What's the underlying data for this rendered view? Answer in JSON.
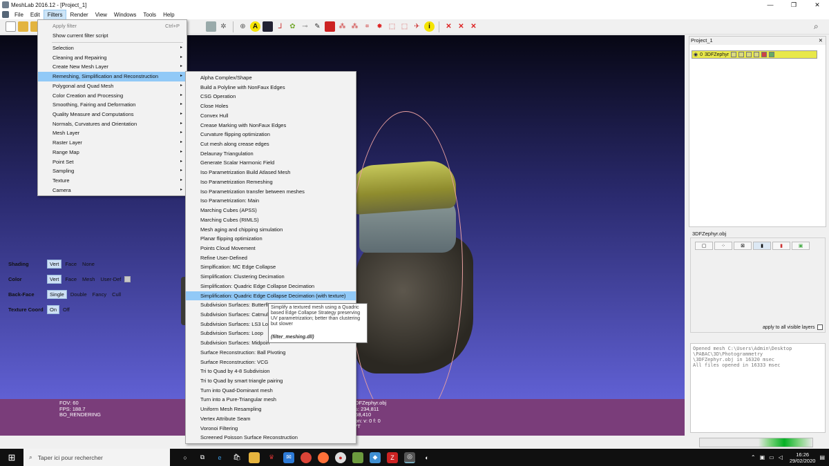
{
  "window": {
    "title": "MeshLab 2016.12 - [Project_1]",
    "minimize": "—",
    "restore": "❐",
    "close": "✕"
  },
  "menubar": [
    "File",
    "Edit",
    "Filters",
    "Render",
    "View",
    "Windows",
    "Tools",
    "Help"
  ],
  "filters_menu": {
    "apply": {
      "label": "Apply filter",
      "shortcut": "Ctrl+P"
    },
    "show_script": "Show current filter script",
    "items": [
      "Selection",
      "Cleaning and Repairing",
      "Create New Mesh Layer",
      "Remeshing, Simplification and Reconstruction",
      "Polygonal and Quad Mesh",
      "Color Creation and Processing",
      "Smoothing, Fairing and Deformation",
      "Quality Measure and Computations",
      "Normals, Curvatures and Orientation",
      "Mesh Layer",
      "Raster Layer",
      "Range Map",
      "Point Set",
      "Sampling",
      "Texture",
      "Camera"
    ],
    "highlighted_index": 3,
    "arrow": "▸"
  },
  "remesh_submenu": {
    "items": [
      "Alpha Complex/Shape",
      "Build a Polyline with NonFaux Edges",
      "CSG Operation",
      "Close Holes",
      "Convex Hull",
      "Crease Marking with NonFaux Edges",
      "Curvature flipping optimization",
      "Cut mesh along crease edges",
      "Delaunay Triangulation",
      "Generate Scalar Harmonic Field",
      "Iso Parametrization Build Atlased Mesh",
      "Iso Parametrization Remeshing",
      "Iso Parametrization transfer between meshes",
      "Iso Parametrization: Main",
      "Marching Cubes (APSS)",
      "Marching Cubes (RIMLS)",
      "Mesh aging and chipping simulation",
      "Planar flipping optimization",
      "Points Cloud Movement",
      "Refine User-Defined",
      "Simplfication: MC Edge Collapse",
      "Simplification: Clustering Decimation",
      "Simplification: Quadric Edge Collapse Decimation",
      "Simplification: Quadric Edge Collapse Decimation (with texture)",
      "Subdivision Surfaces: Butterfly",
      "Subdivision Surfaces: Catmull",
      "Subdivision Surfaces: LS3 Loo",
      "Subdivision Surfaces: Loop",
      "Subdivision Surfaces: Midpoin",
      "Surface Reconstruction: Ball Pivoting",
      "Surface Reconstruction: VCG",
      "Tri to Quad by 4-8 Subdivision",
      "Tri to Quad by smart triangle pairing",
      "Turn into Quad-Dominant mesh",
      "Turn into a Pure-Triangular mesh",
      "Uniform Mesh Resampling",
      "Vertex Attribute Seam",
      "Voronoi Filtering",
      "Screened Poisson Surface Reconstruction"
    ],
    "highlighted_index": 23
  },
  "tooltip": {
    "text": "Simplify a textured mesh using a Quadric based Edge Collapse Strategy preserving UV parametrization; better than clustering but slower",
    "dll": "(filter_meshing.dll)"
  },
  "viewport_info": {
    "left": [
      "FOV: 60",
      "FPS:   188.7",
      "BO_RENDERING"
    ],
    "right": [
      "3DFZephyr.obj",
      "es: 234,811",
      "468,410",
      "tion: v: 0 f: 0",
      "WT"
    ]
  },
  "layer_panel": {
    "title": "Project_1",
    "close": "✕",
    "layer_index": "0",
    "layer_name": "3DFZephyr"
  },
  "properties": {
    "title": "3DFZephyr.obj",
    "shading": {
      "label": "Shading",
      "options": [
        "Vert",
        "Face",
        "None"
      ]
    },
    "color": {
      "label": "Color",
      "options": [
        "Vert",
        "Face",
        "Mesh",
        "User-Def"
      ]
    },
    "backface": {
      "label": "Back-Face",
      "options": [
        "Single",
        "Double",
        "Fancy",
        "Cull"
      ]
    },
    "texcoord": {
      "label": "Texture Coord",
      "options": [
        "On",
        "Off"
      ]
    },
    "apply_all": "apply to all visible layers"
  },
  "log": [
    "Opened mesh C:\\Users\\Admin\\Desktop",
    "\\PABAC\\3D\\Photogrammetry",
    "\\3DFZephyr.obj in 16320 msec",
    "All files opened in 16333 msec"
  ],
  "taskbar": {
    "search_placeholder": "Taper ici pour rechercher",
    "time": "16:26",
    "date": "29/02/2020"
  },
  "colors": {
    "menu_highlight": "#91c9f7",
    "info_bar": "#7a3d7a",
    "layer_highlight": "#e8e84a"
  }
}
